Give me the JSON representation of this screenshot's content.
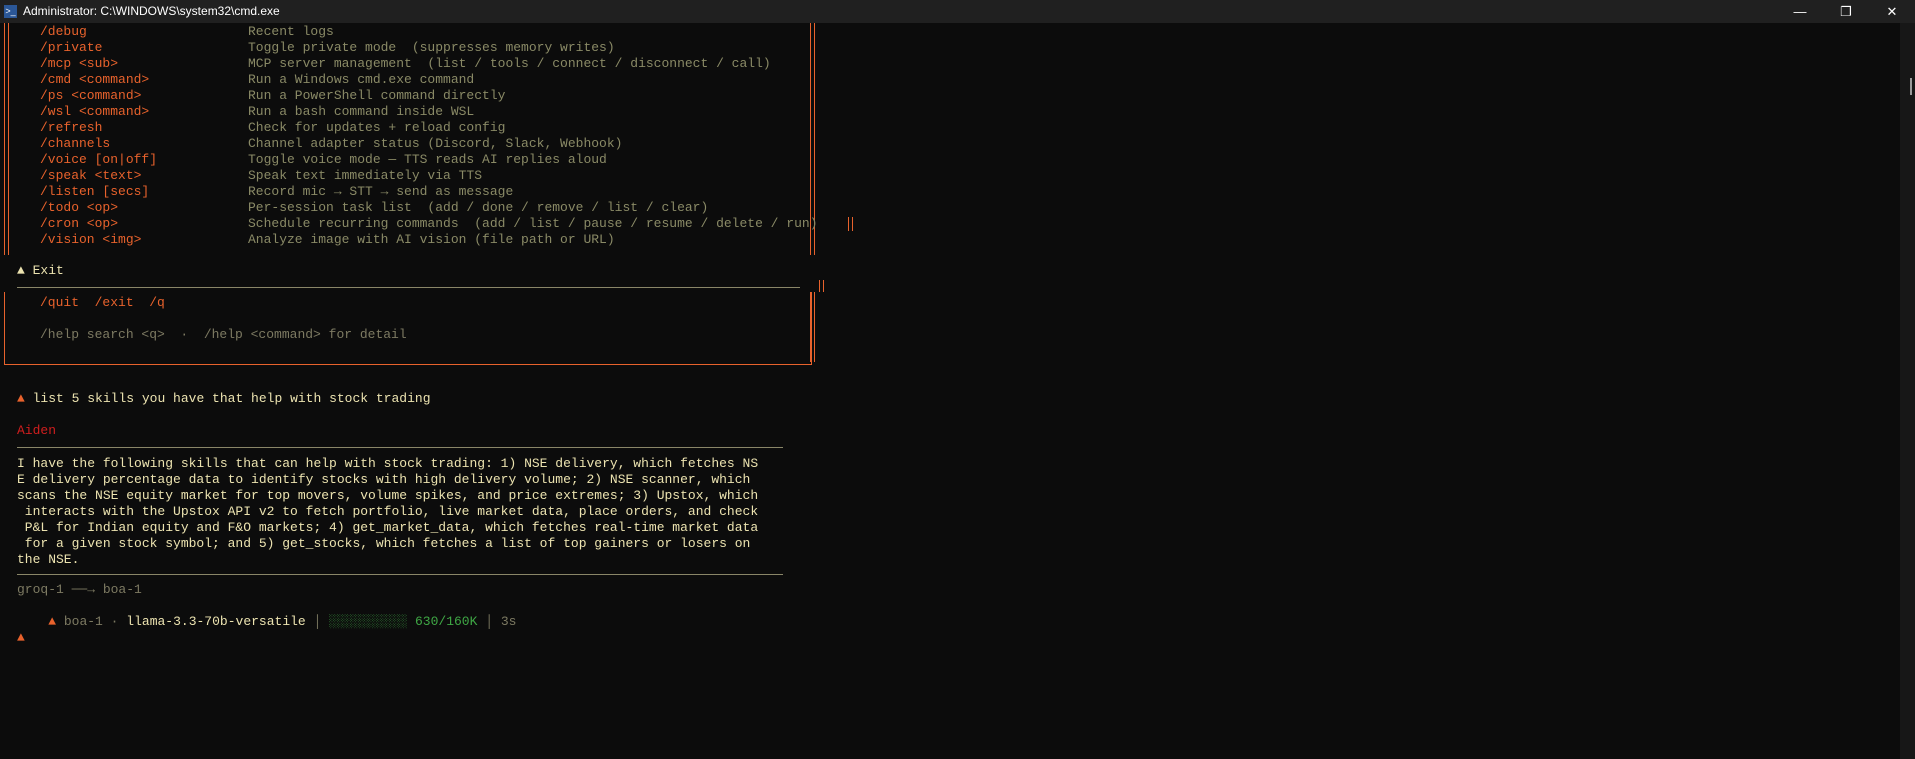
{
  "window": {
    "title": "Administrator: C:\\WINDOWS\\system32\\cmd.exe",
    "icon": "powershell-icon",
    "minimize": "—",
    "maximize": "❐",
    "close": "✕"
  },
  "help": {
    "commands": [
      {
        "cmd": "/debug",
        "desc": "Recent logs"
      },
      {
        "cmd": "/private",
        "desc": "Toggle private mode  (suppresses memory writes)"
      },
      {
        "cmd": "/mcp <sub>",
        "desc": "MCP server management  (list / tools / connect / disconnect / call)"
      },
      {
        "cmd": "/cmd <command>",
        "desc": "Run a Windows cmd.exe command"
      },
      {
        "cmd": "/ps <command>",
        "desc": "Run a PowerShell command directly"
      },
      {
        "cmd": "/wsl <command>",
        "desc": "Run a bash command inside WSL"
      },
      {
        "cmd": "/refresh",
        "desc": "Check for updates + reload config"
      },
      {
        "cmd": "/channels",
        "desc": "Channel adapter status (Discord, Slack, Webhook)"
      },
      {
        "cmd": "/voice [on|off]",
        "desc": "Toggle voice mode — TTS reads AI replies aloud"
      },
      {
        "cmd": "/speak <text>",
        "desc": "Speak text immediately via TTS"
      },
      {
        "cmd": "/listen [secs]",
        "desc": "Record mic → STT → send as message"
      },
      {
        "cmd": "/todo <op>",
        "desc": "Per-session task list  (add / done / remove / list / clear)"
      },
      {
        "cmd": "/cron <op>",
        "desc": "Schedule recurring commands  (add / list / pause / resume / delete / run)"
      },
      {
        "cmd": "/vision <img>",
        "desc": "Analyze image with AI vision (file path or URL)"
      }
    ],
    "exit_section": {
      "marker": "▲",
      "title": "Exit",
      "commands": "/quit  /exit  /q"
    },
    "footer": "/help search <q>  ·  /help <command> for detail"
  },
  "conversation": {
    "prompt_marker": "▲",
    "user_message": "list 5 skills you have that help with stock trading",
    "assistant_name": "Aiden",
    "response_lines": [
      "I have the following skills that can help with stock trading: 1) NSE delivery, which fetches NS",
      "E delivery percentage data to identify stocks with high delivery volume; 2) NSE scanner, which",
      "scans the NSE equity market for top movers, volume spikes, and price extremes; 3) Upstox, which",
      " interacts with the Upstox API v2 to fetch portfolio, live market data, place orders, and check",
      " P&L for Indian equity and F&O markets; 4) get_market_data, which fetches real-time market data",
      " for a given stock symbol; and 5) get_stocks, which fetches a list of top gainers or losers on",
      "the NSE."
    ],
    "routing": "groq-1 ──→ boa-1",
    "status": {
      "provider": "boa-1",
      "sep": "·",
      "model": "llama-3.3-70b-versatile",
      "bar": "│",
      "context_bar": "░░░░░░░░░░",
      "context": "630/160K",
      "context_fraction": 0.004,
      "elapsed": "3s"
    }
  },
  "colors": {
    "command": "#e8622c",
    "description": "#8a8a66",
    "text": "#ece3b0",
    "assistant": "#d01e1e",
    "context": "#3fa845",
    "background": "#0c0c0c"
  }
}
